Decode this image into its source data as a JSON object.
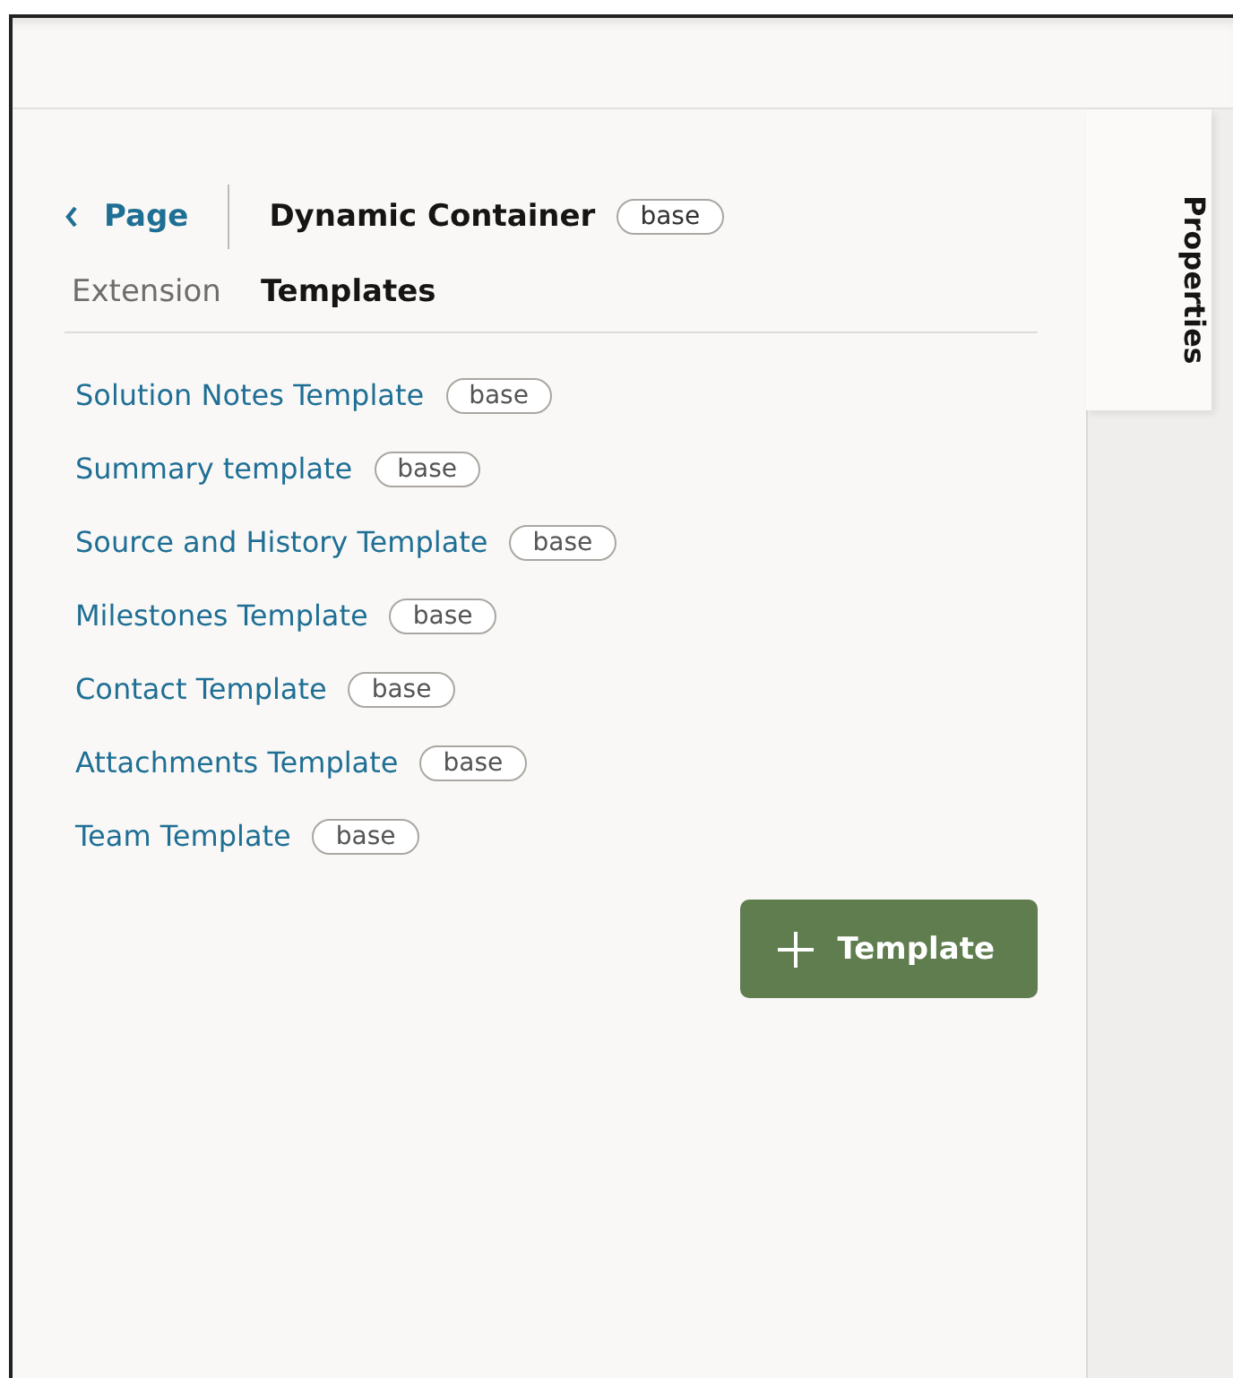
{
  "header": {
    "back_label": "Page",
    "title": "Dynamic Container",
    "badge": "base"
  },
  "tabs": [
    {
      "label": "Extension",
      "selected": false
    },
    {
      "label": "Templates",
      "selected": true
    }
  ],
  "templates": [
    {
      "name": "Solution Notes Template",
      "badge": "base"
    },
    {
      "name": "Summary template",
      "badge": "base"
    },
    {
      "name": "Source and History Template",
      "badge": "base"
    },
    {
      "name": "Milestones Template",
      "badge": "base"
    },
    {
      "name": "Contact Template",
      "badge": "base"
    },
    {
      "name": "Attachments Template",
      "badge": "base"
    },
    {
      "name": "Team Template",
      "badge": "base"
    }
  ],
  "add_button": "Template",
  "side_tab": {
    "label": "Properties",
    "selected": true
  }
}
